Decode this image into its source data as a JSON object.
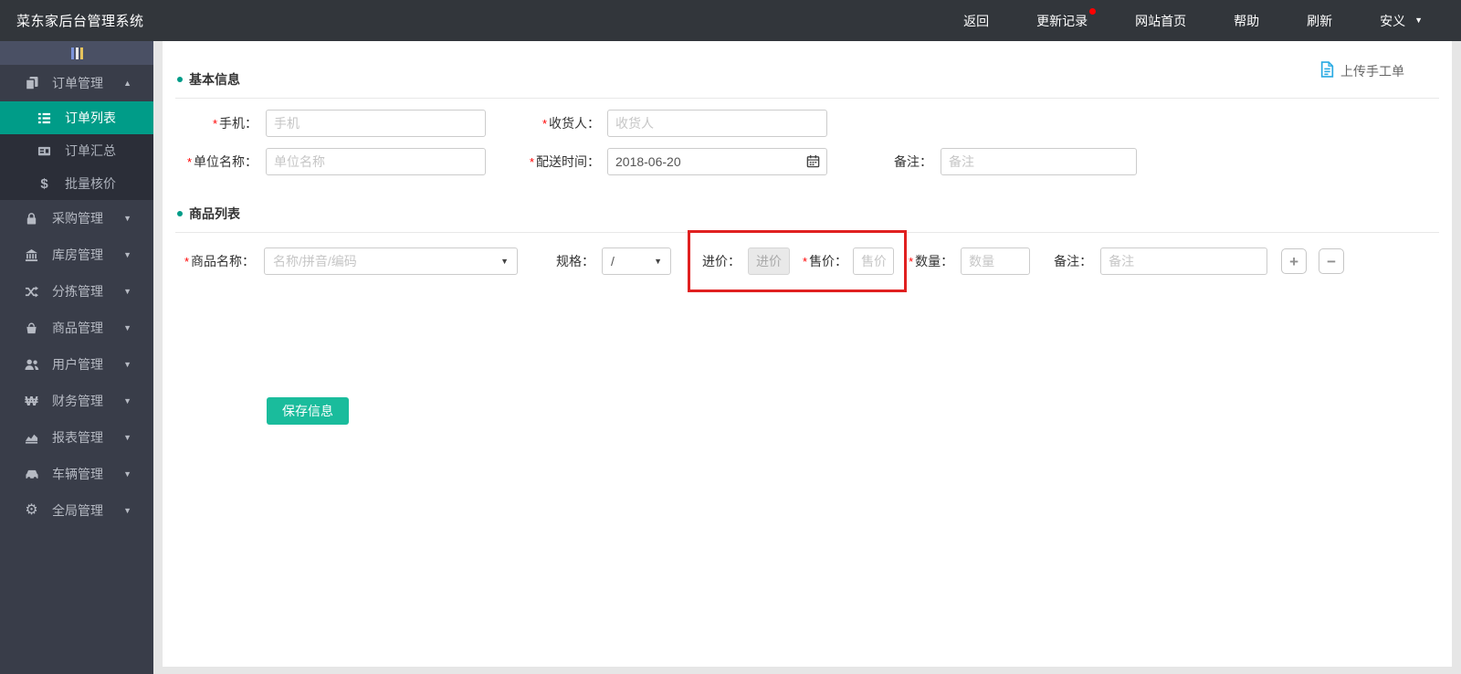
{
  "topbar": {
    "title": "菜东家后台管理系统",
    "nav": [
      {
        "label": "返回"
      },
      {
        "label": "更新记录",
        "badge": true
      },
      {
        "label": "网站首页"
      },
      {
        "label": "帮助"
      },
      {
        "label": "刷新"
      }
    ],
    "user": {
      "name": "安义"
    }
  },
  "sidebar": {
    "sections": [
      {
        "label": "订单管理",
        "expanded": true,
        "children": [
          {
            "label": "订单列表",
            "active": true
          },
          {
            "label": "订单汇总"
          },
          {
            "label": "批量核价"
          }
        ]
      },
      {
        "label": "采购管理"
      },
      {
        "label": "库房管理"
      },
      {
        "label": "分拣管理"
      },
      {
        "label": "商品管理"
      },
      {
        "label": "用户管理"
      },
      {
        "label": "财务管理"
      },
      {
        "label": "报表管理"
      },
      {
        "label": "车辆管理"
      },
      {
        "label": "全局管理"
      }
    ]
  },
  "main": {
    "upload_link": "上传手工单",
    "required_mark": "*",
    "basic_section": {
      "title": "基本信息",
      "phone": {
        "label": "手机：",
        "placeholder": "手机"
      },
      "receiver": {
        "label": "收货人：",
        "placeholder": "收货人"
      },
      "company": {
        "label": "单位名称：",
        "placeholder": "单位名称"
      },
      "delivery": {
        "label": "配送时间：",
        "value": "2018-06-20"
      },
      "remark": {
        "label": "备注：",
        "placeholder": "备注"
      }
    },
    "product_section": {
      "title": "商品列表",
      "name": {
        "label": "商品名称：",
        "placeholder": "名称/拼音/编码"
      },
      "spec": {
        "label": "规格：",
        "value": "/"
      },
      "purchase": {
        "label": "进价：",
        "placeholder": "进价",
        "disabled": true
      },
      "sale": {
        "label": "售价：",
        "placeholder": "售价"
      },
      "quantity": {
        "label": "数量：",
        "placeholder": "数量"
      },
      "remark": {
        "label": "备注：",
        "placeholder": "备注"
      }
    },
    "save_button": "保存信息"
  },
  "icons": {
    "caret_up": "▲",
    "caret_down": "▼",
    "dollar": "$",
    "won": "₩",
    "gear": "⚙",
    "plus": "+",
    "minus": "−"
  },
  "colors": {
    "accent_teal": "#009c88",
    "save_button_teal": "#1abc9c",
    "highlight_box_red": "#e02020",
    "badge_red": "#ff0000",
    "upload_icon_blue": "#29aae3",
    "topbar_bg": "#32363b",
    "sidebar_bg": "#393d49",
    "submenu_bg": "#2b2e38"
  }
}
